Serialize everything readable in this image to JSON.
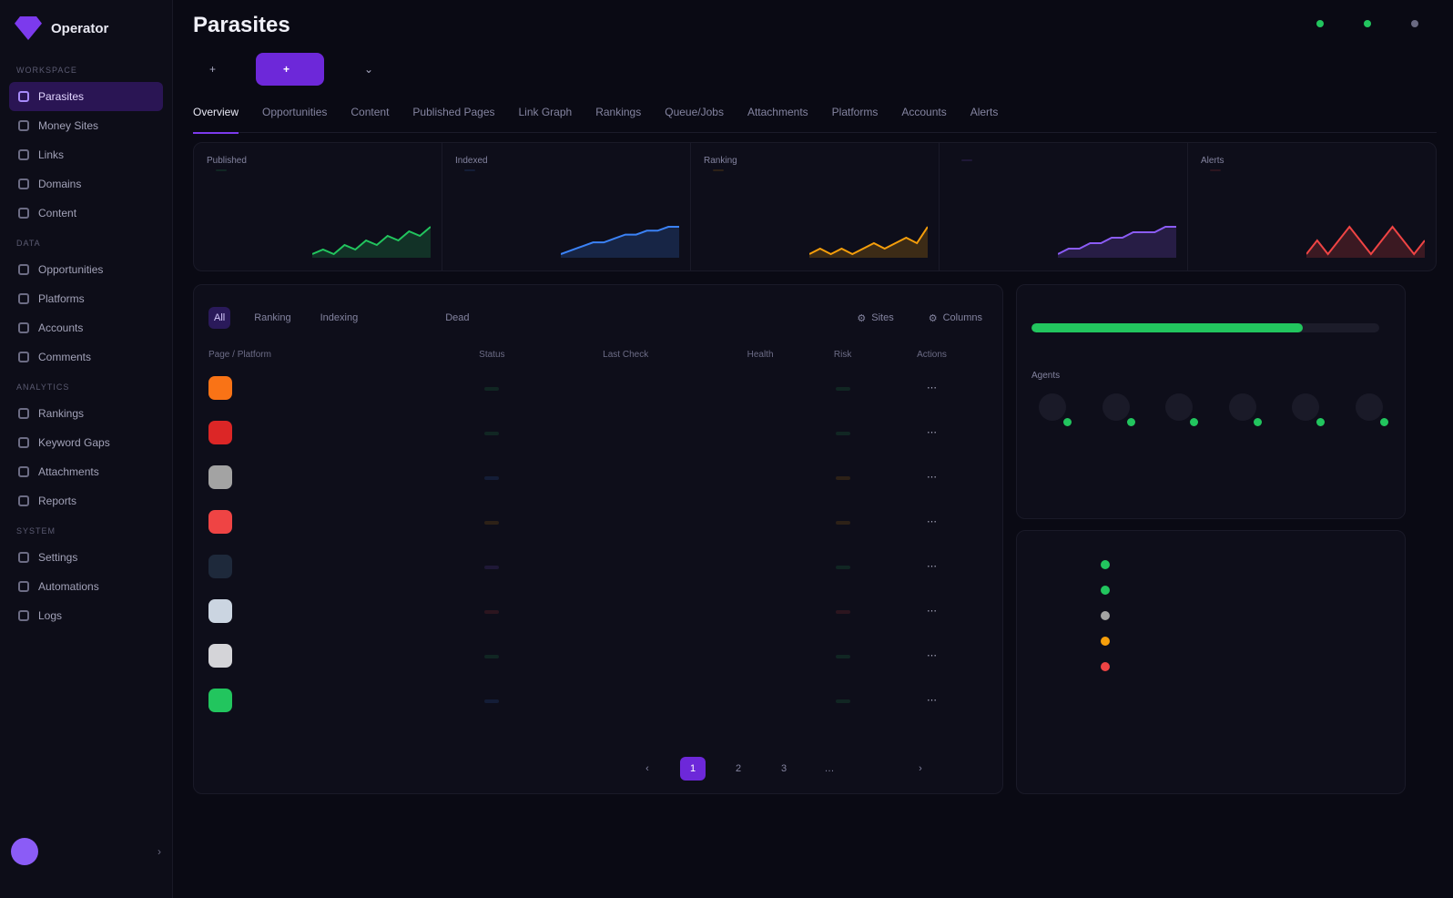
{
  "brand": {
    "eyebrow": "",
    "name": "Operator"
  },
  "nav": [
    {
      "section": "Workspace",
      "items": [
        "Parasites",
        "Money Sites",
        "Links",
        "Domains",
        "Content"
      ]
    },
    {
      "section": "Data",
      "items": [
        "Opportunities",
        "Platforms",
        "Accounts",
        "Comments"
      ]
    },
    {
      "section": "Analytics",
      "items": [
        "Rankings",
        "Keyword Gaps",
        "Attachments",
        "Reports"
      ]
    },
    {
      "section": "System",
      "items": [
        "Settings",
        "Automations",
        "Logs"
      ]
    }
  ],
  "user": {
    "initials": "",
    "name": "",
    "role": ""
  },
  "header": {
    "eyebrow": "",
    "title": "Parasites",
    "subtitle": "",
    "status_items": [
      {
        "label": "",
        "color": "#22c55e"
      },
      {
        "label": "",
        "color": "#22c55e"
      },
      {
        "label": "",
        "color": "#6a6a82"
      }
    ]
  },
  "actions": {
    "primary": "",
    "secondary": "",
    "tertiary": ""
  },
  "tabs": [
    {
      "label": "Overview",
      "count": ""
    },
    {
      "label": "Opportunities",
      "count": ""
    },
    {
      "label": "Content",
      "count": ""
    },
    {
      "label": "Published Pages",
      "count": ""
    },
    {
      "label": "Link Graph",
      "count": ""
    },
    {
      "label": "Rankings",
      "count": ""
    },
    {
      "label": "Queue/Jobs",
      "count": ""
    },
    {
      "label": "Attachments",
      "count": ""
    },
    {
      "label": "Platforms",
      "count": ""
    },
    {
      "label": "Accounts",
      "count": ""
    },
    {
      "label": "Alerts",
      "count": ""
    }
  ],
  "live_label": "",
  "stats": [
    {
      "label": "Published",
      "value": "",
      "delta": "",
      "color": "#22c55e",
      "desc": "",
      "spark": [
        3,
        4,
        3,
        5,
        4,
        6,
        5,
        7,
        6,
        8,
        7,
        9
      ]
    },
    {
      "label": "Indexed",
      "value": "",
      "delta": "",
      "color": "#3b82f6",
      "desc": "",
      "spark": [
        2,
        3,
        4,
        5,
        5,
        6,
        7,
        7,
        8,
        8,
        9,
        9
      ]
    },
    {
      "label": "Ranking",
      "value": "",
      "delta": "",
      "color": "#f59e0b",
      "desc": "",
      "spark": [
        3,
        4,
        3,
        4,
        3,
        4,
        5,
        4,
        5,
        6,
        5,
        8
      ]
    },
    {
      "label": "",
      "value": "",
      "delta": "",
      "color": "#8b5cf6",
      "desc": "",
      "spark": [
        3,
        4,
        4,
        5,
        5,
        6,
        6,
        7,
        7,
        7,
        8,
        8
      ]
    },
    {
      "label": "Alerts",
      "value": "",
      "delta": "",
      "color": "#ef4444",
      "desc": "",
      "spark": [
        4,
        5,
        4,
        5,
        6,
        5,
        4,
        5,
        6,
        5,
        4,
        5
      ]
    }
  ],
  "table": {
    "title": "",
    "filters": [
      {
        "label": "All",
        "count": ""
      },
      {
        "label": "Ranking",
        "count": ""
      },
      {
        "label": "Indexing",
        "count": ""
      },
      {
        "label": "",
        "count": ""
      },
      {
        "label": "",
        "count": ""
      },
      {
        "label": "Dead",
        "count": ""
      }
    ],
    "filter_right": [
      "Sites",
      "Columns"
    ],
    "columns": [
      "Page / Platform",
      "Status",
      "",
      "",
      "Last Check",
      "",
      "Health",
      "Risk",
      "Actions"
    ],
    "rows": [
      {
        "icon": "#f97316",
        "name": "",
        "sub": "",
        "status": "",
        "status_color": "#22c55e",
        "c3": "",
        "c4": "",
        "c5": "",
        "c6": "",
        "health": "",
        "risk": "",
        "risk_color": "#22c55e"
      },
      {
        "icon": "#dc2626",
        "name": "",
        "sub": "",
        "status": "",
        "status_color": "#22c55e",
        "c3": "",
        "c4": "",
        "c5": "",
        "c6": "",
        "health": "",
        "risk": "",
        "risk_color": "#22c55e"
      },
      {
        "icon": "#a3a3a3",
        "name": "",
        "sub": "",
        "status": "",
        "status_color": "#3b82f6",
        "c3": "",
        "c4": "",
        "c5": "",
        "c6": "",
        "health": "",
        "risk": "",
        "risk_color": "#f59e0b"
      },
      {
        "icon": "#ef4444",
        "name": "",
        "sub": "",
        "status": "",
        "status_color": "#f59e0b",
        "c3": "",
        "c4": "",
        "c5": "",
        "c6": "",
        "health": "",
        "risk": "",
        "risk_color": "#f59e0b"
      },
      {
        "icon": "#1e293b",
        "name": "",
        "sub": "",
        "status": "",
        "status_color": "#8b5cf6",
        "c3": "",
        "c4": "",
        "c5": "",
        "c6": "",
        "health": "",
        "risk": "",
        "risk_color": "#22c55e"
      },
      {
        "icon": "#cbd5e1",
        "name": "",
        "sub": "",
        "status": "",
        "status_color": "#ef4444",
        "c3": "",
        "c4": "",
        "c5": "",
        "c6": "",
        "health": "",
        "risk": "",
        "risk_color": "#ef4444"
      },
      {
        "icon": "#d4d4d8",
        "name": "",
        "sub": "",
        "status": "",
        "status_color": "#22c55e",
        "c3": "",
        "c4": "",
        "c5": "",
        "c6": "",
        "health": "",
        "risk": "",
        "risk_color": "#22c55e"
      },
      {
        "icon": "#22c55e",
        "name": "",
        "sub": "",
        "status": "",
        "status_color": "#3b82f6",
        "c3": "",
        "c4": "",
        "c5": "",
        "c6": "",
        "health": "",
        "risk": "",
        "risk_color": "#22c55e"
      }
    ],
    "footer": "",
    "pages": [
      "1",
      "2",
      "3",
      "…",
      ""
    ]
  },
  "pipeline": {
    "title": "",
    "link": "",
    "bar_label": "",
    "bar_value": "",
    "bar_pct": "",
    "bar_fraction": 0.78,
    "metrics": [
      {
        "label": "",
        "value": ""
      },
      {
        "label": "",
        "value": ""
      },
      {
        "label": "",
        "value": ""
      },
      {
        "label": "",
        "value": ""
      },
      {
        "label": "",
        "value": ""
      }
    ],
    "agents_label": "Agents",
    "agents": [
      "",
      "",
      "",
      "",
      "",
      ""
    ]
  },
  "activity": {
    "title": "",
    "items": [
      {
        "time": "",
        "text": "",
        "sub": "",
        "color": "#22c55e"
      },
      {
        "time": "",
        "text": "",
        "sub": "",
        "color": "#22c55e"
      },
      {
        "time": "",
        "text": "",
        "sub": "",
        "color": "#a3a3a3"
      },
      {
        "time": "",
        "text": "",
        "sub": "",
        "color": "#f59e0b"
      },
      {
        "time": "",
        "text": "",
        "sub": "",
        "color": "#ef4444"
      }
    ],
    "link": ""
  }
}
